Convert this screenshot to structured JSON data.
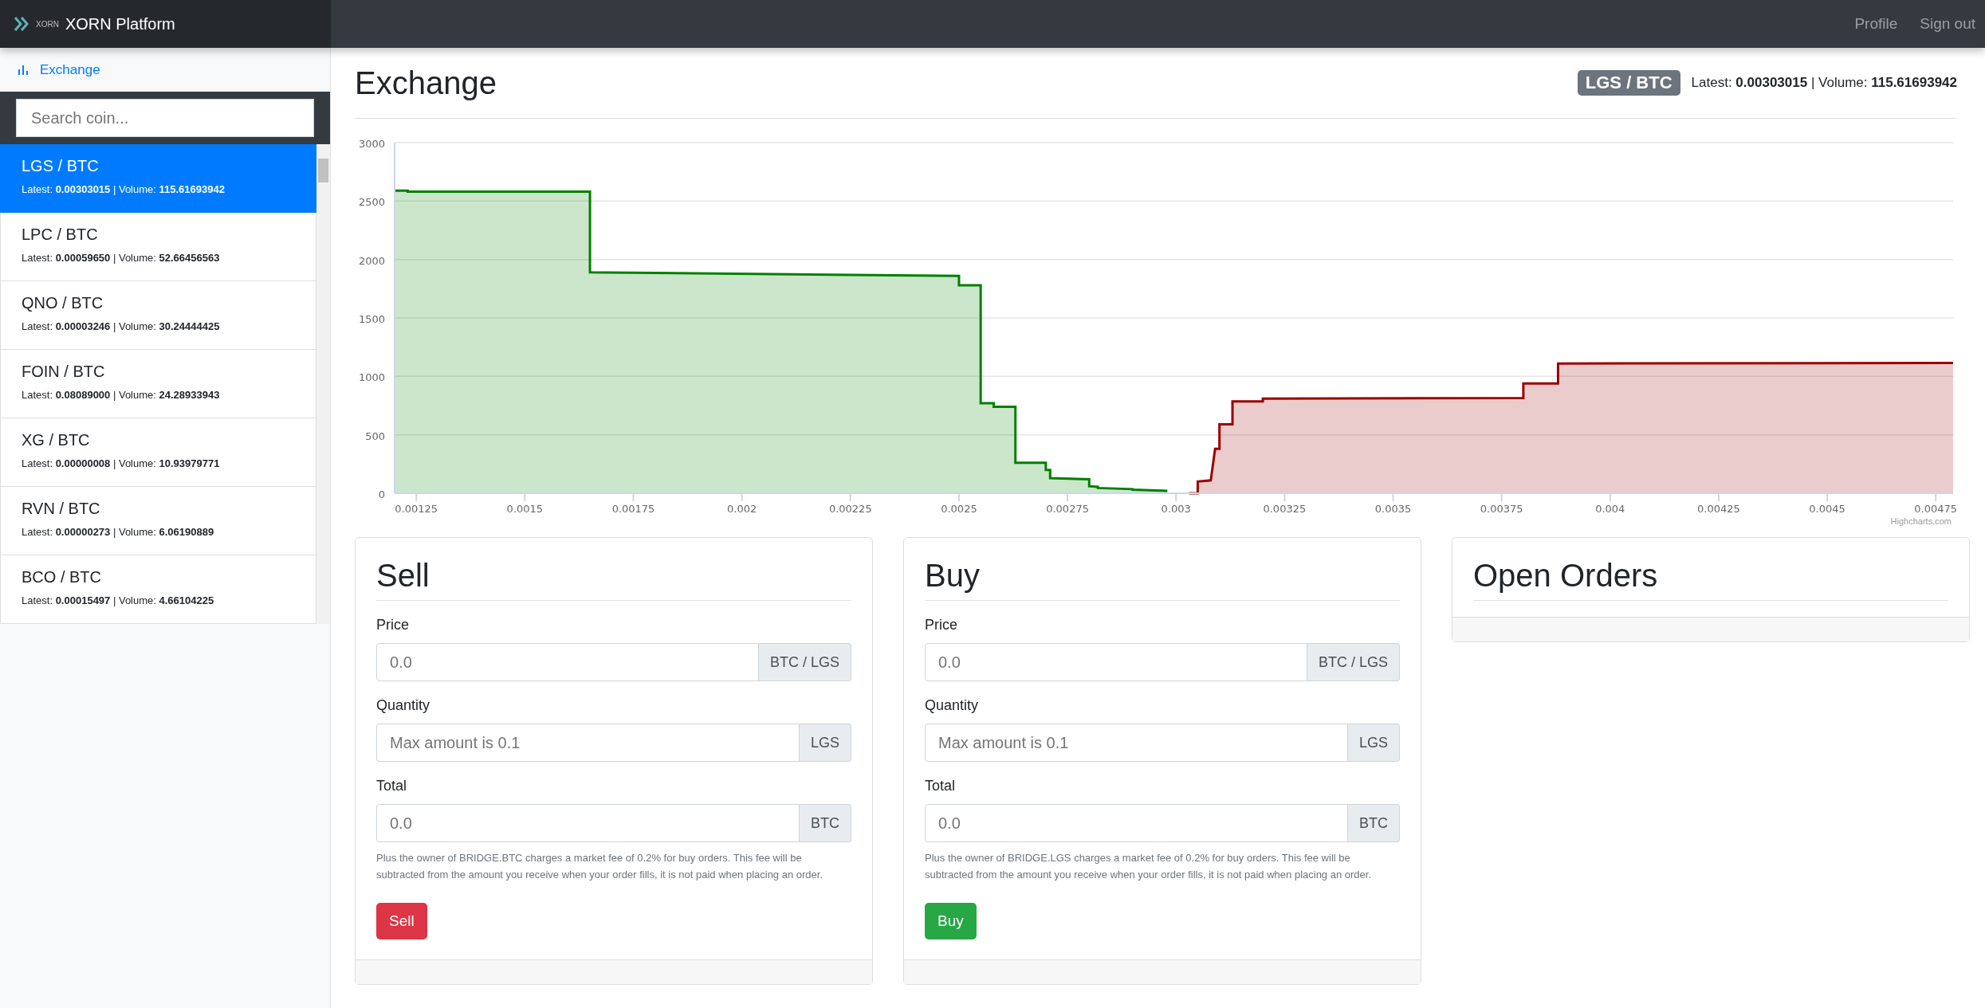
{
  "navbar": {
    "logo_text": "XORN",
    "brand": "XORN Platform",
    "links": [
      "Profile",
      "Sign out"
    ]
  },
  "sidebar": {
    "nav": [
      {
        "label": "Exchange",
        "selected": true
      }
    ],
    "search": {
      "placeholder": "Search coin..."
    },
    "markets": [
      {
        "pair": "LGS / BTC",
        "stats": "Latest: **0.00303015** | Volume: **115.61693942**",
        "selected": true
      },
      {
        "pair": "LPC / BTC",
        "stats": "Latest: **0.00059650** | Volume: **52.66456563**",
        "selected": false
      },
      {
        "pair": "QNO / BTC",
        "stats": "Latest: **0.00003246** | Volume: **30.24444425**",
        "selected": false
      },
      {
        "pair": "FOIN / BTC",
        "stats": "Latest: **0.08089000** | Volume: **24.28933943**",
        "selected": false
      },
      {
        "pair": "XG / BTC",
        "stats": "Latest: **0.00000008** | Volume: **10.93979771**",
        "selected": false
      },
      {
        "pair": "RVN / BTC",
        "stats": "Latest: **0.00000273** | Volume: **6.06190889**",
        "selected": false
      },
      {
        "pair": "BCO / BTC",
        "stats": "Latest: **0.00015497** | Volume: **4.66104225**",
        "selected": false
      }
    ]
  },
  "header": {
    "title": "Exchange",
    "pair": "LGS / BTC",
    "stats": "Latest: **0.00303015** | Volume: **115.61693942**"
  },
  "chart": {
    "credit": "Highcharts.com",
    "chart_data": {
      "type": "area",
      "grid": true,
      "x": [
        0.0012,
        0.00123,
        0.00123,
        0.00165,
        0.00165,
        0.0018,
        0.0022,
        0.0025,
        0.0025,
        0.00255,
        0.00255,
        0.00258,
        0.00258,
        0.00263,
        0.00263,
        0.0027,
        0.0027,
        0.00271,
        0.00271,
        0.0028,
        0.0028,
        0.00282,
        0.00282,
        0.0029,
        0.0029,
        0.00298,
        0.00303,
        0.00305,
        0.00305,
        0.00308,
        0.00309,
        0.0031,
        0.0031,
        0.00313,
        0.00313,
        0.0032,
        0.0032,
        0.0038,
        0.0038,
        0.00388,
        0.00388,
        0.00479
      ],
      "series": [
        {
          "color": "#008000",
          "values": [
            2590,
            2590,
            2580,
            2580,
            1890,
            1885,
            1870,
            1860,
            1780,
            1780,
            770,
            770,
            740,
            740,
            260,
            260,
            200,
            200,
            130,
            120,
            60,
            55,
            45,
            35,
            30,
            20,
            null,
            null,
            null,
            null,
            null,
            null,
            null,
            null,
            null,
            null,
            null,
            null,
            null,
            null,
            null,
            null
          ]
        },
        {
          "color": "#990000",
          "values": [
            null,
            null,
            null,
            null,
            null,
            null,
            null,
            null,
            null,
            null,
            null,
            null,
            null,
            null,
            null,
            null,
            null,
            null,
            null,
            null,
            null,
            null,
            null,
            null,
            null,
            null,
            0,
            0,
            100,
            110,
            380,
            380,
            590,
            590,
            785,
            785,
            810,
            815,
            940,
            940,
            1110,
            1115
          ]
        }
      ],
      "xlim": [
        0.0012,
        0.00479
      ],
      "ylim": [
        0,
        3000
      ],
      "xticks": [
        0.00125,
        0.0015,
        0.00175,
        0.002,
        0.00225,
        0.0025,
        0.00275,
        0.003,
        0.00325,
        0.0035,
        0.00375,
        0.004,
        0.00425,
        0.0045,
        0.00475
      ],
      "yticks": [
        0,
        500,
        1000,
        1500,
        2000,
        2500,
        3000
      ]
    }
  },
  "forms": [
    {
      "kind": "sell",
      "title": "Sell",
      "fields": [
        {
          "label": "Price",
          "placeholder": "0.0",
          "unit": "BTC / LGS"
        },
        {
          "label": "Quantity",
          "placeholder": "Max amount is 0.1",
          "unit": "LGS"
        },
        {
          "label": "Total",
          "placeholder": "0.0",
          "unit": "BTC"
        }
      ],
      "note": "Plus the owner of BRIDGE.BTC charges a market fee of 0.2% for buy orders. This fee will be subtracted from the amount you receive when your order fills, it is not paid when placing an order.",
      "button": "Sell"
    },
    {
      "kind": "buy",
      "title": "Buy",
      "fields": [
        {
          "label": "Price",
          "placeholder": "0.0",
          "unit": "BTC / LGS"
        },
        {
          "label": "Quantity",
          "placeholder": "Max amount is 0.1",
          "unit": "LGS"
        },
        {
          "label": "Total",
          "placeholder": "0.0",
          "unit": "BTC"
        }
      ],
      "note": "Plus the owner of BRIDGE.LGS charges a market fee of 0.2% for buy orders. This fee will be subtracted from the amount you receive when your order fills, it is not paid when placing an order.",
      "button": "Buy"
    }
  ],
  "open_orders": {
    "title": "Open Orders"
  }
}
